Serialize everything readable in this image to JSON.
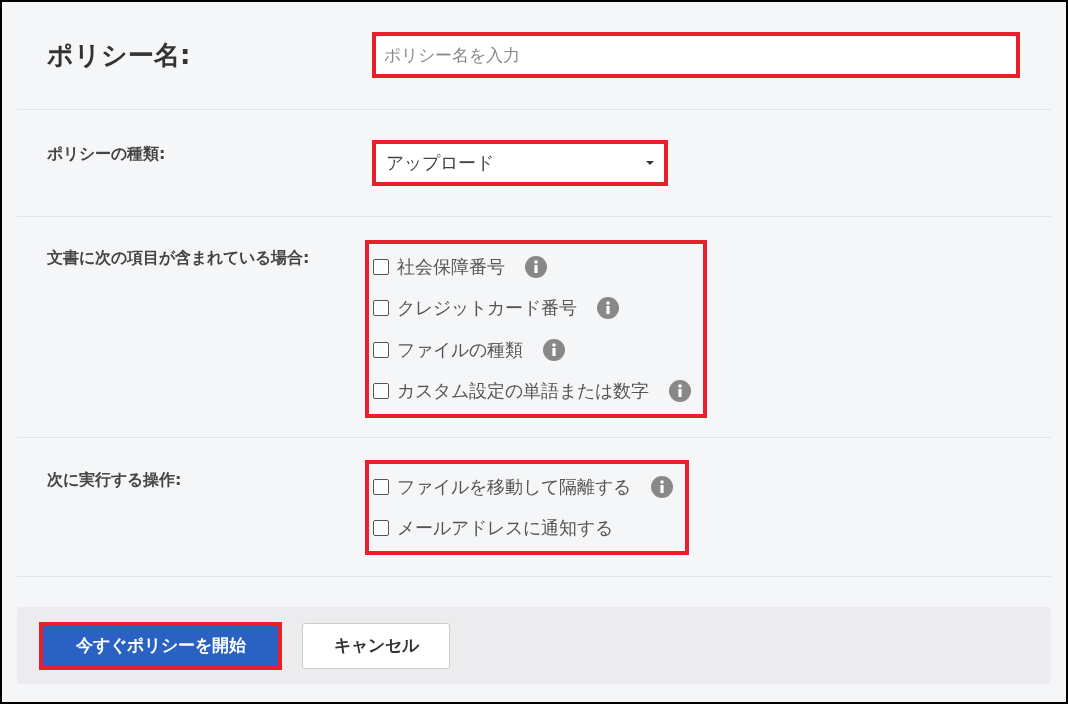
{
  "policy_name": {
    "label": "ポリシー名:",
    "placeholder": "ポリシー名を入力"
  },
  "policy_type": {
    "label": "ポリシーの種類:",
    "value": "アップロード"
  },
  "conditions": {
    "label": "文書に次の項目が含まれている場合:",
    "options": [
      {
        "label": "社会保障番号",
        "checked": false,
        "info": true
      },
      {
        "label": "クレジットカード番号",
        "checked": false,
        "info": true
      },
      {
        "label": "ファイルの種類",
        "checked": false,
        "info": true
      },
      {
        "label": "カスタム設定の単語または数字",
        "checked": false,
        "info": true
      }
    ]
  },
  "actions": {
    "label": "次に実行する操作:",
    "options": [
      {
        "label": "ファイルを移動して隔離する",
        "checked": false,
        "info": true
      },
      {
        "label": "メールアドレスに通知する",
        "checked": false,
        "info": false
      }
    ]
  },
  "buttons": {
    "start": "今すぐポリシーを開始",
    "cancel": "キャンセル"
  }
}
